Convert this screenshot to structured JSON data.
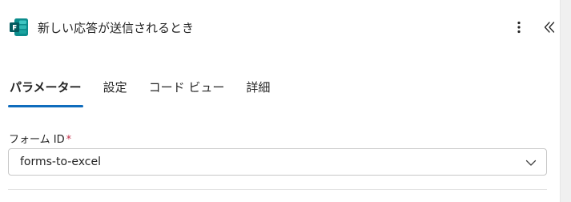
{
  "header": {
    "title": "新しい応答が送信されるとき",
    "app_icon": "microsoft-forms-icon",
    "more_icon": "more-vertical-icon",
    "collapse_icon": "double-chevron-left-icon"
  },
  "tabs": [
    {
      "label": "パラメーター",
      "active": true
    },
    {
      "label": "設定",
      "active": false
    },
    {
      "label": "コード ビュー",
      "active": false
    },
    {
      "label": "詳細",
      "active": false
    }
  ],
  "form": {
    "field_label": "フォーム ID",
    "required_mark": "*",
    "selected_value": "forms-to-excel"
  },
  "colors": {
    "accent": "#0f6cbd",
    "forms_dark": "#035a5f",
    "forms_mid": "#0b8c8c",
    "forms_light": "#3ec5c1",
    "required": "#c4314b"
  }
}
